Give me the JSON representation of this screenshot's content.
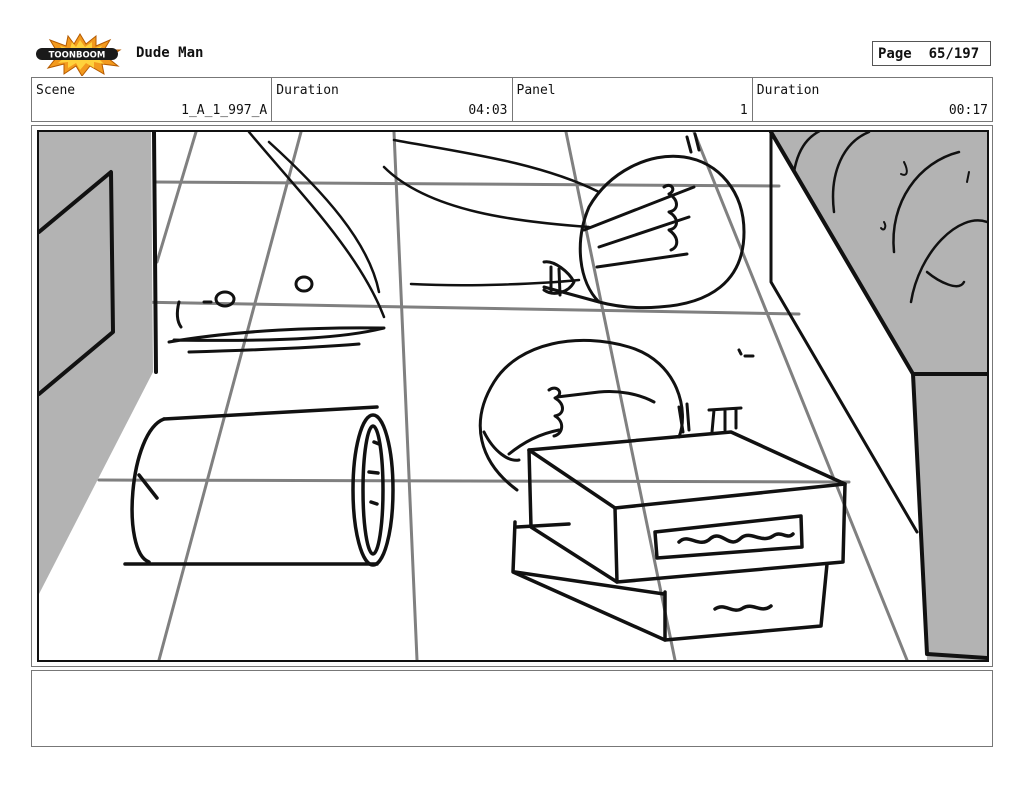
{
  "header": {
    "logo_text": "TOONBOOM",
    "project_title": "Dude Man",
    "page_label": "Page",
    "page_value": "65/197"
  },
  "info": {
    "scene_label": "Scene",
    "scene_value": "1_A_1_997_A",
    "scene_duration_label": "Duration",
    "scene_duration_value": "04:03",
    "panel_label": "Panel",
    "panel_value": "1",
    "panel_duration_label": "Duration",
    "panel_duration_value": "00:17"
  },
  "notes": {
    "text": ""
  }
}
